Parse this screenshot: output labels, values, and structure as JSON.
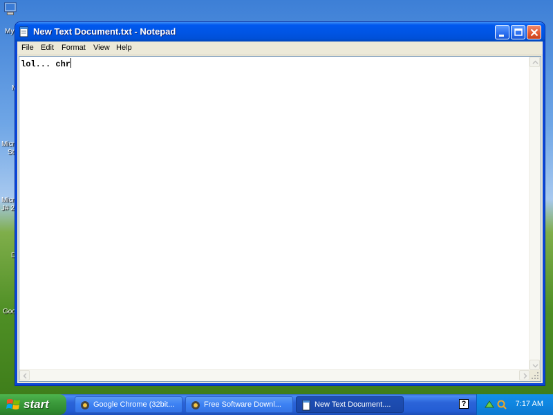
{
  "desktop": {
    "icon_labels": [
      "My",
      "M",
      "Micr",
      "St",
      "Micr",
      "J# 2",
      "D",
      "Goo"
    ]
  },
  "window": {
    "title": "New Text Document.txt - Notepad",
    "menu": [
      "File",
      "Edit",
      "Format",
      "View",
      "Help"
    ],
    "content": "lol... chr"
  },
  "taskbar": {
    "start_label": "start",
    "tasks": [
      {
        "label": "Google Chrome (32bit...",
        "icon": "chrome-setup-icon",
        "active": false
      },
      {
        "label": "Free Software Downl...",
        "icon": "chrome-setup-icon",
        "active": false
      },
      {
        "label": "New Text Document....",
        "icon": "notepad-icon",
        "active": true
      }
    ],
    "help_glyph": "?",
    "clock": "7:17 AM"
  },
  "colors": {
    "titlebar_blue": "#0055e5",
    "start_green": "#3c9b3c",
    "tray_blue": "#0f85e0",
    "close_red": "#e2572f"
  }
}
